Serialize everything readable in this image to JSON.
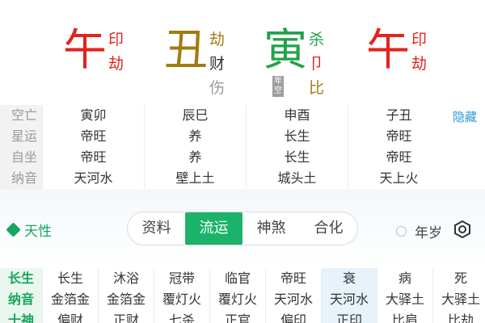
{
  "colors": {
    "red": "#e2241d",
    "olive": "#a07c10",
    "green": "#21a24a",
    "gray": "#9a9a9a",
    "accent": "#1bb36a",
    "link": "#2b9bd6"
  },
  "pillars": [
    {
      "branch": "午",
      "branch_color": "#e2241d",
      "hidden": [
        {
          "text": "印",
          "color": "#e2241d"
        },
        {
          "text": "劫",
          "color": "#e2241d"
        }
      ]
    },
    {
      "branch": "丑",
      "branch_color": "#a07c10",
      "hidden": [
        {
          "text": "劫",
          "color": "#a07c10"
        },
        {
          "text": "财",
          "color": "#333333"
        },
        {
          "text": "伤",
          "color": "#9a9a9a"
        }
      ]
    },
    {
      "branch": "寅",
      "branch_color": "#21a24a",
      "tag": "年空",
      "hidden": [
        {
          "text": "杀",
          "color": "#21a24a"
        },
        {
          "text": "卩",
          "color": "#e2241d"
        },
        {
          "text": "比",
          "color": "#a07c10"
        }
      ]
    },
    {
      "branch": "午",
      "branch_color": "#e2241d",
      "hidden": [
        {
          "text": "印",
          "color": "#e2241d"
        },
        {
          "text": "劫",
          "color": "#e2241d"
        }
      ]
    }
  ],
  "info": {
    "hide_label": "隐藏",
    "rows": [
      {
        "label": "空亡",
        "cells": [
          "寅卯",
          "辰巳",
          "申酉",
          "子丑"
        ]
      },
      {
        "label": "星运",
        "cells": [
          "帝旺",
          "养",
          "长生",
          "帝旺"
        ]
      },
      {
        "label": "自坐",
        "cells": [
          "帝旺",
          "养",
          "长生",
          "帝旺"
        ]
      },
      {
        "label": "纳音",
        "cells": [
          "天河水",
          "壁上土",
          "城头土",
          "天上火"
        ]
      }
    ]
  },
  "band": {
    "tianxing": "天性",
    "tabs": [
      "资料",
      "流运",
      "神煞",
      "合化"
    ],
    "active_tab": 1,
    "nian_sui": "年岁"
  },
  "grid": {
    "highlight_col": 5,
    "rows": [
      {
        "label": "长生",
        "cells": [
          "长生",
          "沐浴",
          "冠带",
          "临官",
          "帝旺",
          "衰",
          "病",
          "死"
        ]
      },
      {
        "label": "纳音",
        "cells": [
          "金箔金",
          "金箔金",
          "覆灯火",
          "覆灯火",
          "天河水",
          "天河水",
          "大驿土",
          "大驿土"
        ]
      },
      {
        "label": "十神",
        "cells": [
          "偏财",
          "正财",
          "七杀",
          "正官",
          "偏印",
          "正印",
          "比肩",
          "比劫"
        ]
      }
    ]
  }
}
